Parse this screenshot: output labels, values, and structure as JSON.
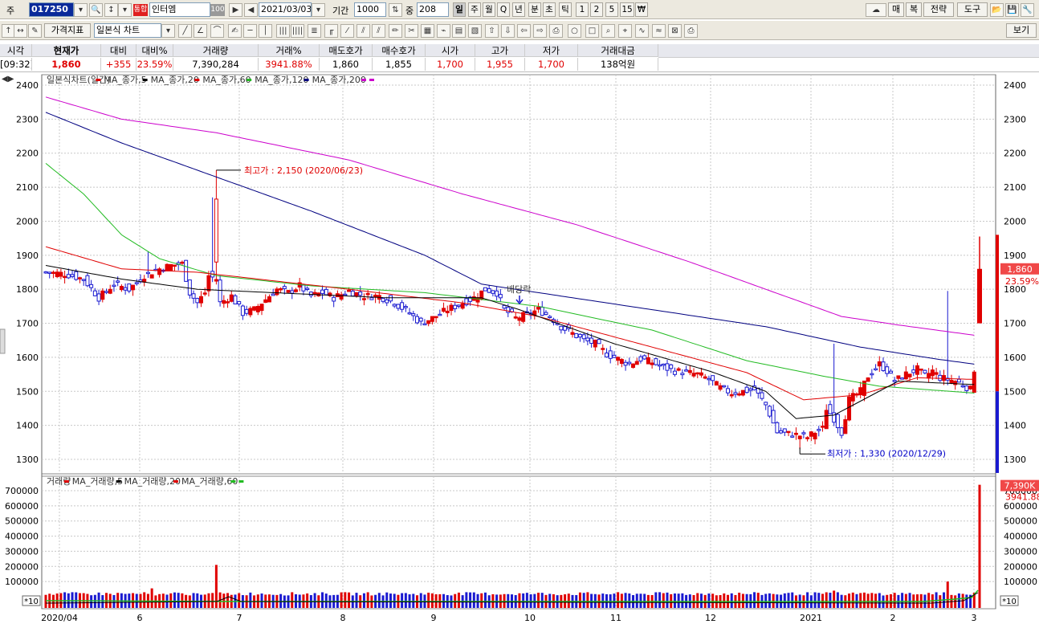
{
  "toolbar1": {
    "market_label": "주",
    "code": "017250",
    "badge": "통합",
    "name": "인터엠",
    "name_badge": "100",
    "date": "2021/03/03",
    "period_label": "기간",
    "period_value": "1000",
    "count_label": "중",
    "count_value": "208",
    "periods": [
      "일",
      "주",
      "월",
      "Q",
      "년",
      "분",
      "초",
      "틱",
      "1",
      "2",
      "5",
      "15",
      "₩"
    ],
    "right_buttons": [
      "매",
      "복",
      "전략",
      "도구"
    ]
  },
  "toolbar2": {
    "indicator_button": "가격지표",
    "chart_type": "일본식 차트",
    "view_button": "보기"
  },
  "quote": {
    "headers": [
      "시각",
      "현재가",
      "대비",
      "대비%",
      "거래량",
      "거래%",
      "매도호가",
      "매수호가",
      "시가",
      "고가",
      "저가",
      "거래대금"
    ],
    "values": [
      "[09:32]",
      "1,860",
      "+355",
      "23.59%",
      "7,390,284",
      "3941.88%",
      "1,860",
      "1,855",
      "1,700",
      "1,955",
      "1,700",
      "138억원"
    ]
  },
  "price_panel": {
    "legend": [
      {
        "text": "일본식차트(일간)",
        "color": "#333333"
      },
      {
        "text": "MA_종가,5",
        "color": "#e00000"
      },
      {
        "text": "MA_종가,20",
        "color": "#000000"
      },
      {
        "text": "MA_종가,60",
        "color": "#e00000"
      },
      {
        "text": "MA_종가,120",
        "color": "#22bb22"
      },
      {
        "text": "MA_종가,200",
        "color": "#000080"
      },
      {
        "text": "",
        "color": "#cc00cc"
      }
    ],
    "high_annotation": "최고가 : 2,150 (2020/06/23)",
    "low_annotation": "최저가 : 1,330 (2020/12/29)",
    "dividend_label": "배당락",
    "current_price_tag": "1,860",
    "change_pct_tag": "23.59%"
  },
  "volume_panel": {
    "legend": [
      {
        "text": "거래량",
        "color": "#333333"
      },
      {
        "text": "MA_거래량,5",
        "color": "#e00000"
      },
      {
        "text": "MA_거래량,20",
        "color": "#000000"
      },
      {
        "text": "MA_거래량,60",
        "color": "#e00000"
      },
      {
        "text": "",
        "color": "#22bb22"
      }
    ],
    "volume_tag": "7,390K",
    "volume_pct_tag": "3941.88%",
    "scale_label": "*10"
  },
  "colors": {
    "up": "#e00000",
    "down": "#1a1ad0",
    "ma5": "#e00000",
    "ma20": "#000000",
    "ma60": "#e00000",
    "ma120": "#22bb22",
    "ma200": "#000080",
    "ma_extra": "#cc00cc",
    "grid": "#c8c8c8"
  },
  "chart_data": {
    "type": "candlestick",
    "price_ticks": [
      1300,
      1400,
      1500,
      1600,
      1700,
      1800,
      1900,
      2000,
      2100,
      2200,
      2300,
      2400
    ],
    "volume_ticks": [
      100000,
      200000,
      300000,
      400000,
      500000,
      600000,
      700000
    ],
    "x_labels": [
      "2020/04",
      "6",
      "7",
      "8",
      "9",
      "10",
      "11",
      "12",
      "2021",
      "2",
      "3"
    ],
    "ylim": [
      1250,
      2430
    ],
    "volume_ylim": [
      0,
      760000
    ],
    "keypoints_close": [
      [
        0,
        1850
      ],
      [
        5,
        1845
      ],
      [
        10,
        1830
      ],
      [
        14,
        1775
      ],
      [
        18,
        1815
      ],
      [
        22,
        1800
      ],
      [
        26,
        1840
      ],
      [
        30,
        1860
      ],
      [
        33,
        1870
      ],
      [
        36,
        1875
      ],
      [
        38,
        1790
      ],
      [
        40,
        1760
      ],
      [
        42,
        1790
      ],
      [
        43,
        1840
      ],
      [
        45,
        1830
      ],
      [
        46,
        1760
      ],
      [
        49,
        1780
      ],
      [
        52,
        1730
      ],
      [
        55,
        1740
      ],
      [
        58,
        1770
      ],
      [
        61,
        1800
      ],
      [
        64,
        1790
      ],
      [
        67,
        1810
      ],
      [
        70,
        1780
      ],
      [
        73,
        1790
      ],
      [
        76,
        1775
      ],
      [
        80,
        1795
      ],
      [
        84,
        1780
      ],
      [
        88,
        1780
      ],
      [
        92,
        1760
      ],
      [
        96,
        1730
      ],
      [
        99,
        1700
      ],
      [
        102,
        1715
      ],
      [
        106,
        1740
      ],
      [
        110,
        1760
      ],
      [
        113,
        1775
      ],
      [
        116,
        1800
      ],
      [
        119,
        1790
      ],
      [
        121,
        1740
      ],
      [
        124,
        1715
      ],
      [
        127,
        1725
      ],
      [
        130,
        1740
      ],
      [
        133,
        1720
      ],
      [
        136,
        1690
      ],
      [
        139,
        1670
      ],
      [
        142,
        1650
      ],
      [
        145,
        1640
      ],
      [
        148,
        1610
      ],
      [
        151,
        1595
      ],
      [
        154,
        1580
      ],
      [
        157,
        1595
      ],
      [
        160,
        1585
      ],
      [
        163,
        1570
      ],
      [
        166,
        1560
      ],
      [
        169,
        1555
      ],
      [
        172,
        1550
      ],
      [
        175,
        1535
      ],
      [
        178,
        1510
      ],
      [
        181,
        1495
      ],
      [
        184,
        1500
      ],
      [
        187,
        1505
      ],
      [
        190,
        1460
      ],
      [
        193,
        1380
      ],
      [
        196,
        1375
      ],
      [
        199,
        1370
      ],
      [
        201,
        1365
      ],
      [
        203,
        1380
      ],
      [
        205,
        1390
      ],
      [
        206,
        1450
      ],
      [
        208,
        1420
      ],
      [
        210,
        1380
      ],
      [
        212,
        1475
      ],
      [
        215,
        1500
      ],
      [
        217,
        1545
      ],
      [
        220,
        1580
      ],
      [
        222,
        1560
      ],
      [
        224,
        1530
      ],
      [
        227,
        1550
      ],
      [
        230,
        1565
      ],
      [
        232,
        1545
      ],
      [
        234,
        1560
      ],
      [
        236,
        1540
      ],
      [
        238,
        1535
      ],
      [
        240,
        1530
      ],
      [
        242,
        1520
      ],
      [
        244,
        1505
      ],
      [
        245,
        1565
      ]
    ],
    "keypoints_ma5": [
      [
        0,
        1840
      ],
      [
        40,
        1780
      ],
      [
        45,
        1800
      ],
      [
        80,
        1790
      ],
      [
        120,
        1760
      ],
      [
        150,
        1610
      ],
      [
        188,
        1495
      ],
      [
        194,
        1375
      ],
      [
        205,
        1390
      ],
      [
        212,
        1460
      ],
      [
        222,
        1565
      ],
      [
        240,
        1530
      ],
      [
        245,
        1560
      ]
    ],
    "keypoints_ma20": [
      [
        0,
        1870
      ],
      [
        20,
        1830
      ],
      [
        40,
        1800
      ],
      [
        60,
        1790
      ],
      [
        90,
        1775
      ],
      [
        115,
        1775
      ],
      [
        125,
        1740
      ],
      [
        150,
        1640
      ],
      [
        175,
        1560
      ],
      [
        190,
        1500
      ],
      [
        198,
        1420
      ],
      [
        208,
        1430
      ],
      [
        225,
        1530
      ],
      [
        245,
        1520
      ]
    ],
    "keypoints_ma60": [
      [
        0,
        1925
      ],
      [
        20,
        1860
      ],
      [
        40,
        1850
      ],
      [
        80,
        1800
      ],
      [
        110,
        1760
      ],
      [
        130,
        1720
      ],
      [
        160,
        1630
      ],
      [
        185,
        1555
      ],
      [
        200,
        1475
      ],
      [
        215,
        1490
      ],
      [
        230,
        1540
      ],
      [
        245,
        1535
      ]
    ],
    "keypoints_ma120": [
      [
        0,
        2170
      ],
      [
        10,
        2080
      ],
      [
        20,
        1960
      ],
      [
        30,
        1890
      ],
      [
        45,
        1840
      ],
      [
        70,
        1810
      ],
      [
        100,
        1790
      ],
      [
        130,
        1750
      ],
      [
        160,
        1680
      ],
      [
        185,
        1590
      ],
      [
        205,
        1545
      ],
      [
        220,
        1515
      ],
      [
        245,
        1495
      ]
    ],
    "keypoints_ma200": [
      [
        0,
        2320
      ],
      [
        20,
        2230
      ],
      [
        40,
        2150
      ],
      [
        70,
        2030
      ],
      [
        100,
        1900
      ],
      [
        115,
        1815
      ],
      [
        130,
        1790
      ],
      [
        160,
        1740
      ],
      [
        190,
        1690
      ],
      [
        215,
        1630
      ],
      [
        235,
        1595
      ],
      [
        245,
        1580
      ]
    ],
    "keypoints_ma_extra": [
      [
        0,
        2365
      ],
      [
        20,
        2300
      ],
      [
        45,
        2260
      ],
      [
        80,
        2180
      ],
      [
        110,
        2080
      ],
      [
        140,
        1990
      ],
      [
        170,
        1880
      ],
      [
        195,
        1780
      ],
      [
        210,
        1720
      ],
      [
        225,
        1695
      ],
      [
        245,
        1665
      ]
    ],
    "last_candle": {
      "open": 1700,
      "high": 1955,
      "low": 1700,
      "close": 1860
    },
    "high_point": {
      "index": 45,
      "value": 2150,
      "date": "2020/06/23"
    },
    "low_point": {
      "index": 199,
      "value": 1330,
      "date": "2020/12/29"
    },
    "volume_spikes": [
      [
        45,
        210000
      ],
      [
        28,
        55000
      ],
      [
        208,
        40000
      ],
      [
        238,
        100000
      ],
      [
        246,
        739028
      ]
    ]
  }
}
